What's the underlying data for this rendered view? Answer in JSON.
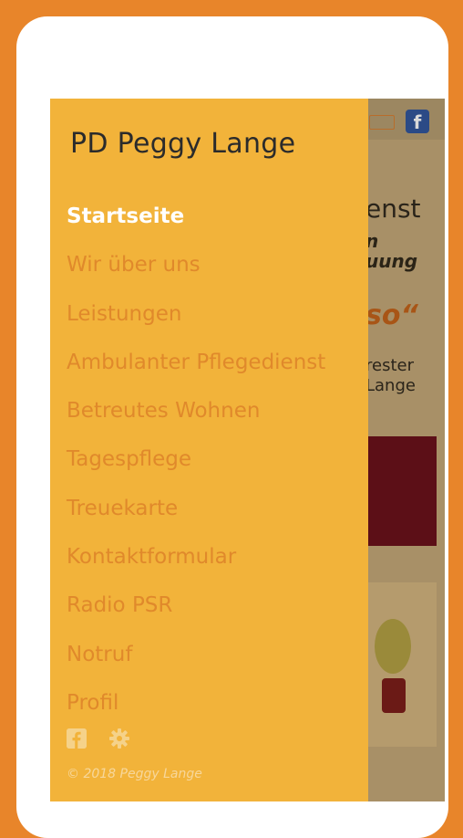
{
  "drawer": {
    "title": "PD Peggy Lange",
    "menu": [
      {
        "label": "Startseite",
        "active": true
      },
      {
        "label": "Wir über uns"
      },
      {
        "label": "Leistungen"
      },
      {
        "label": "Ambulanter Pflegedienst"
      },
      {
        "label": "Betreutes Wohnen"
      },
      {
        "label": "Tagespflege"
      },
      {
        "label": "Treuekarte"
      },
      {
        "label": "Kontaktformular"
      },
      {
        "label": "Radio PSR"
      },
      {
        "label": "Notruf"
      },
      {
        "label": "Profil"
      }
    ],
    "footer_icons": [
      "facebook-icon",
      "gear-icon"
    ],
    "copyright": "© 2018 Peggy Lange"
  },
  "background": {
    "header_icon": "facebook-icon",
    "text_fragments": [
      "enst",
      "n",
      "uung",
      "so“",
      "rester",
      "Lange"
    ]
  },
  "colors": {
    "frame": "#E8852A",
    "drawer": "#F2B33A",
    "menu_text": "#E0892B",
    "active_text": "#FFFFFF",
    "title_text": "#2B2B2B"
  }
}
